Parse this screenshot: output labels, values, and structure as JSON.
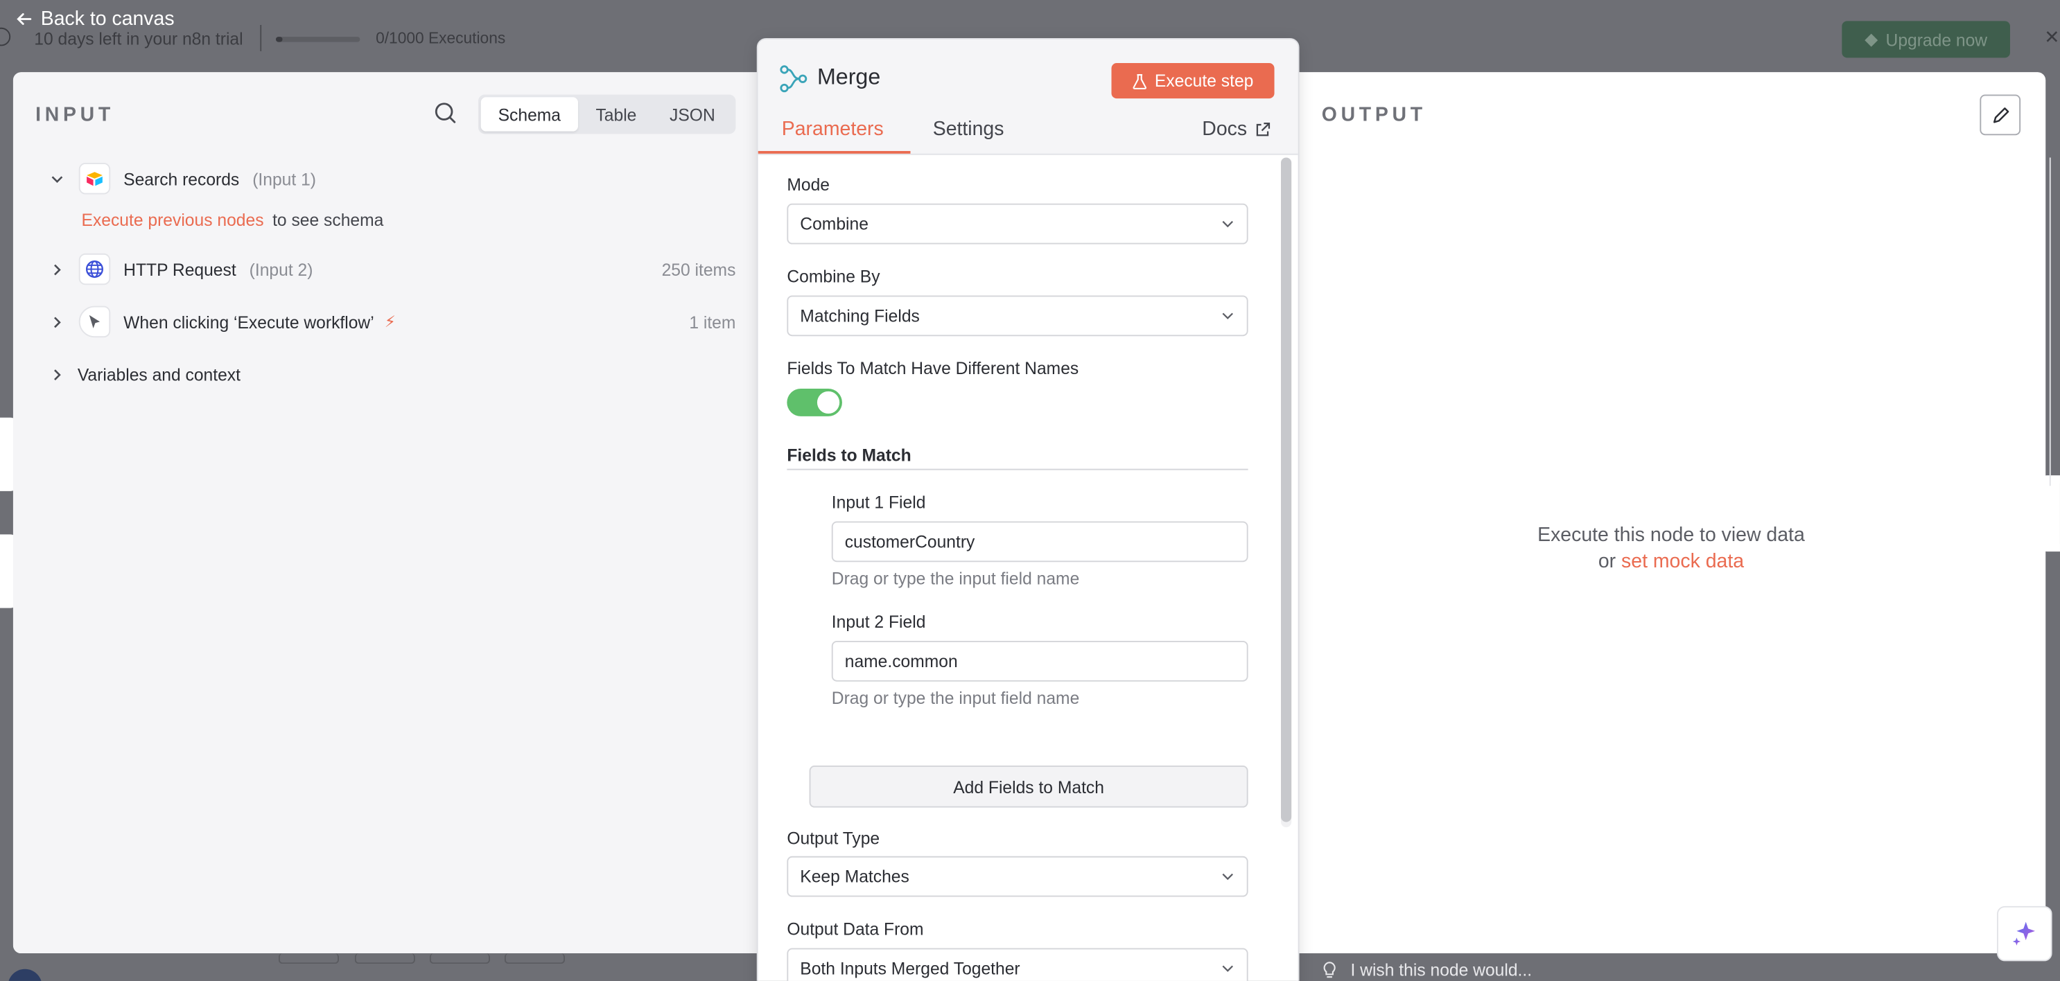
{
  "trial": {
    "text": "10 days left in your n8n trial",
    "executions": "0/1000 Executions",
    "upgrade_label": "Upgrade now",
    "usage_fraction": 0
  },
  "nav": {
    "back_label": "Back to canvas"
  },
  "input_panel": {
    "title": "INPUT",
    "view_tabs": [
      "Schema",
      "Table",
      "JSON"
    ],
    "active_view": "Schema",
    "nodes": [
      {
        "name": "Search records",
        "input": "(Input 1)",
        "count": "",
        "icon": "airtable-icon",
        "expanded": true
      },
      {
        "name": "HTTP Request",
        "input": "(Input 2)",
        "count": "250 items",
        "icon": "globe-icon",
        "expanded": false
      },
      {
        "name": "When clicking ‘Execute workflow’",
        "input": "",
        "count": "1 item",
        "icon": "pointer-icon",
        "expanded": false
      }
    ],
    "execute_previous_link": "Execute previous nodes",
    "execute_previous_rest": "to see schema",
    "variables_label": "Variables and context"
  },
  "node_panel": {
    "title": "Merge",
    "execute_label": "Execute step",
    "tabs": [
      "Parameters",
      "Settings"
    ],
    "active_tab": "Parameters",
    "docs_label": "Docs",
    "mode": {
      "label": "Mode",
      "value": "Combine"
    },
    "combine_by": {
      "label": "Combine By",
      "value": "Matching Fields"
    },
    "different_names": {
      "label": "Fields To Match Have Different Names",
      "enabled": true
    },
    "fields_to_match": {
      "title": "Fields to Match",
      "input1": {
        "label": "Input 1 Field",
        "value": "customerCountry",
        "hint": "Drag or type the input field name"
      },
      "input2": {
        "label": "Input 2 Field",
        "value": "name.common",
        "hint": "Drag or type the input field name"
      },
      "add_label": "Add Fields to Match"
    },
    "output_type": {
      "label": "Output Type",
      "value": "Keep Matches"
    },
    "output_data_from": {
      "label": "Output Data From",
      "value": "Both Inputs Merged Together"
    }
  },
  "output_panel": {
    "title": "OUTPUT",
    "message": "Execute this node to view data",
    "or_text": "or",
    "mock_link": "set mock data"
  },
  "feedback": {
    "text": "I wish this node would..."
  },
  "colors": {
    "accent": "#ea6b50",
    "toggle_on": "#5fc06b",
    "overlay": "#6e6f75"
  }
}
